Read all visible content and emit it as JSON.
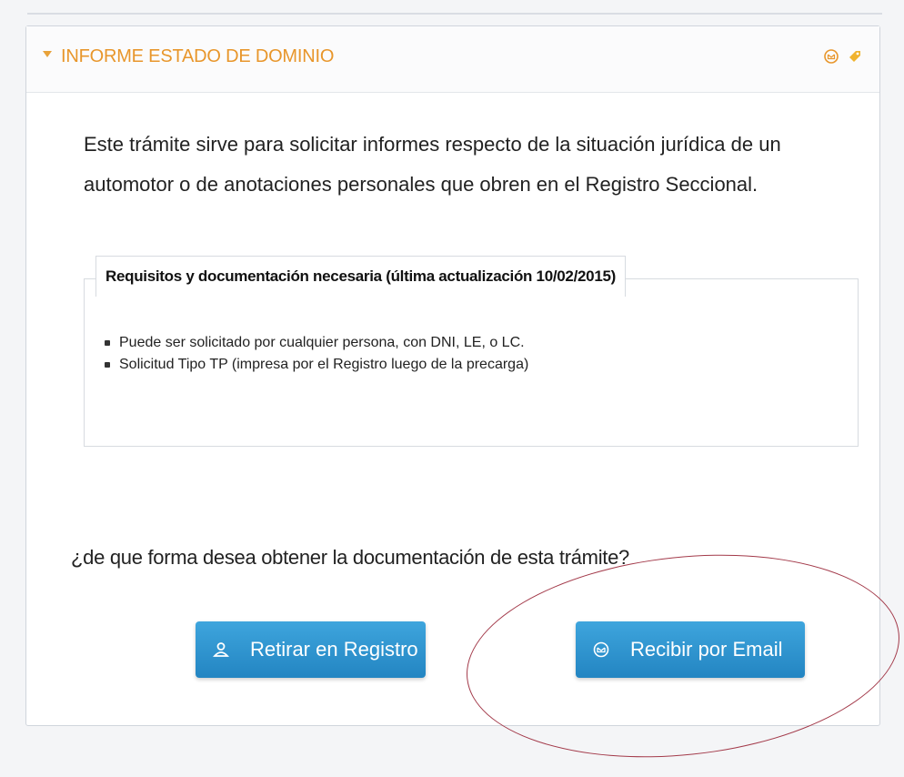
{
  "panel": {
    "title": "INFORME ESTADO DE DOMINIO",
    "header_icons": [
      "envelope-icon",
      "tag-icon"
    ]
  },
  "intro_text": "Este trámite sirve para solicitar informes respecto de la situación jurídica de un automotor o de anotaciones personales que obren en el Registro Seccional.",
  "requirements": {
    "legend": "Requisitos y documentación necesaria (última actualización 10/02/2015)",
    "items": [
      "Puede ser solicitado por cualquier persona, con DNI, LE, o LC.",
      "Solicitud Tipo TP (impresa por el Registro luego de la precarga)"
    ]
  },
  "question": "¿de que forma desea obtener la documentación de esta trámite?",
  "buttons": {
    "retirar": "Retirar en Registro",
    "email": "Recibir por Email"
  },
  "colors": {
    "accent": "#e8962b",
    "button": "#2b8fcc",
    "annotation_circle": "#a33a4a"
  }
}
